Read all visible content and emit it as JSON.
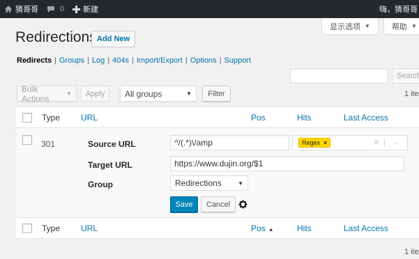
{
  "adminbar": {
    "site_name": "猜哥哥",
    "comments_count": "0",
    "new_label": "新建",
    "greeting": "嗨，猜哥哥"
  },
  "screen_tabs": {
    "screen_options": "显示选项",
    "help": "帮助"
  },
  "page": {
    "title": "Redirections",
    "add_new": "Add New"
  },
  "subnav": {
    "items": [
      "Redirects",
      "Groups",
      "Log",
      "404s",
      "Import/Export",
      "Options",
      "Support"
    ],
    "current_index": 0
  },
  "search": {
    "button_label": "Search"
  },
  "toolbar": {
    "bulk_actions": "Bulk Actions",
    "apply": "Apply",
    "group_filter": "All groups",
    "filter": "Filter",
    "items_count": "1 ite"
  },
  "table": {
    "columns": {
      "type": "Type",
      "url": "URL",
      "pos": "Pos",
      "hits": "Hits",
      "last_access": "Last Access"
    },
    "edit_row": {
      "type": "301",
      "source_label": "Source URL",
      "source_value": "^/(.*)\\/amp",
      "flag": "Regex",
      "target_label": "Target URL",
      "target_value": "https://www.dujin.org/$1",
      "group_label": "Group",
      "group_value": "Redirections",
      "save": "Save",
      "cancel": "Cancel"
    }
  },
  "bottom": {
    "items_count": "1 ite"
  },
  "colors": {
    "adminbar_bg": "#23282d",
    "link": "#0073aa",
    "primary_button": "#0085ba",
    "flag_tag": "#ffd700"
  }
}
